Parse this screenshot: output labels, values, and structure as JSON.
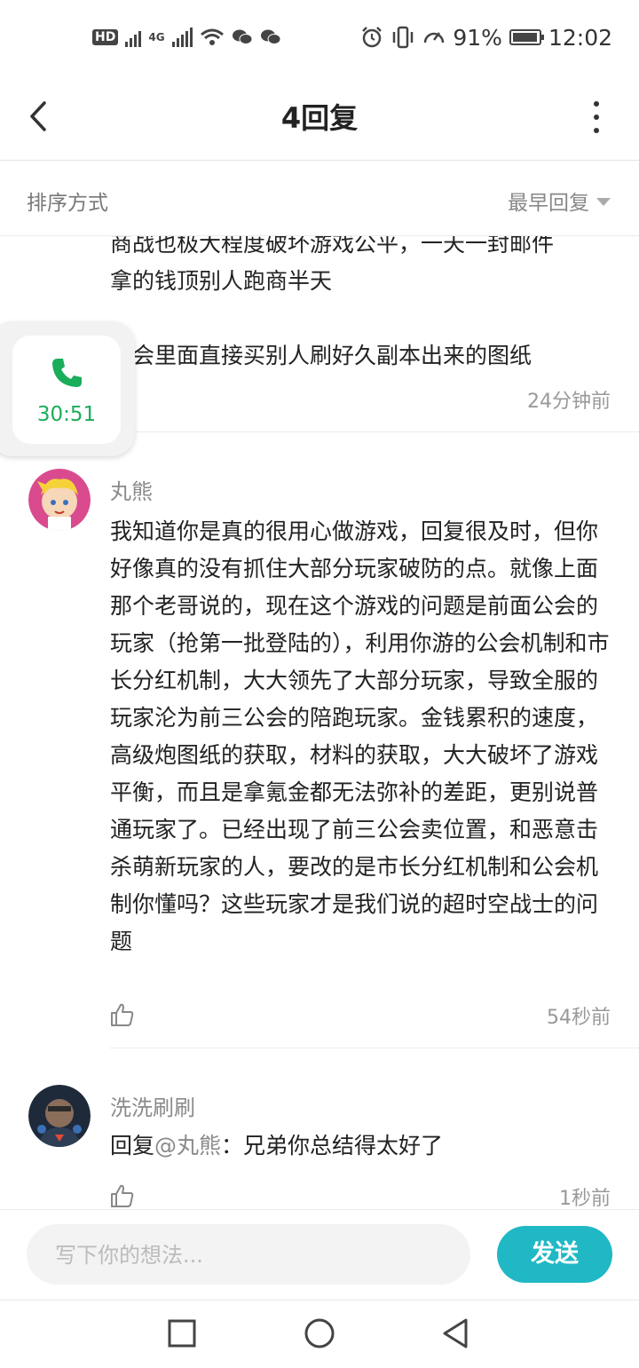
{
  "status_bar": {
    "hd_label": "HD",
    "network_label": "4G",
    "battery_percent": "91%",
    "clock": "12:02"
  },
  "header": {
    "title": "4回复"
  },
  "sort": {
    "label": "排序方式",
    "value": "最早回复"
  },
  "call": {
    "duration": "30:51",
    "accent": "#1aad5a"
  },
  "comments": [
    {
      "text": "商战也极大程度破坏游戏公平，一天一封邮件\n拿的钱顶别人跑商半天\n\n公会里面直接买别人刷好久副本出来的图纸",
      "time": "24分钟前"
    },
    {
      "username": "丸熊",
      "text": "我知道你是真的很用心做游戏，回复很及时，但你好像真的没有抓住大部分玩家破防的点。就像上面那个老哥说的，现在这个游戏的问题是前面公会的玩家（抢第一批登陆的），利用你游的公会机制和市长分红机制，大大领先了大部分玩家，导致全服的玩家沦为前三公会的陪跑玩家。金钱累积的速度，高级炮图纸的获取，材料的获取，大大破坏了游戏平衡，而且是拿氪金都无法弥补的差距，更别说普通玩家了。已经出现了前三公会卖位置，和恶意击杀萌新玩家的人，要改的是市长分红机制和公会机制你懂吗？这些玩家才是我们说的超时空战士的问题",
      "time": "54秒前"
    },
    {
      "username": "洗洗刷刷",
      "reply_prefix": "回复",
      "reply_target": "@丸熊",
      "reply_text": "：兄弟你总结得太好了",
      "time": "1秒前"
    }
  ],
  "composer": {
    "placeholder": "写下你的想法...",
    "send_label": "发送",
    "send_color": "#20b8c4"
  }
}
